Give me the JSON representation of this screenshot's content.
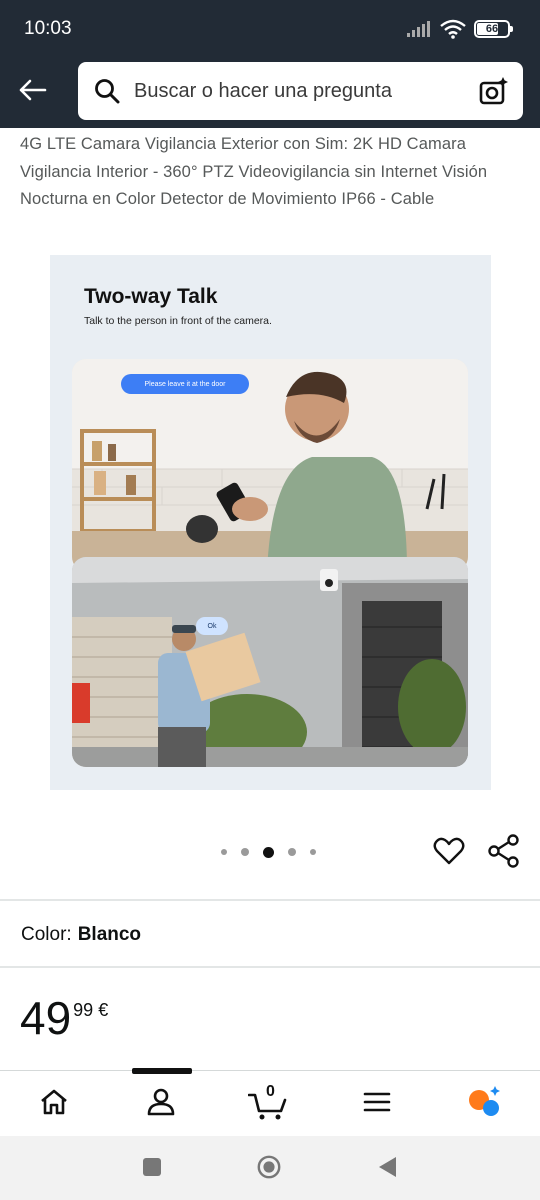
{
  "status_bar": {
    "time": "10:03",
    "battery": "66"
  },
  "search": {
    "placeholder": "Buscar o hacer una pregunta"
  },
  "product": {
    "title": "4G LTE Camara Vigilancia Exterior con Sim: 2K HD Camara Vigilancia Interior - 360° PTZ Videovigilancia sin Internet Visión Nocturna en Color Detector de Movimiento IP66 - Cable",
    "image": {
      "heading": "Two-way Talk",
      "subheading": "Talk to the person in front of the camera.",
      "bubble_top": "Please leave it at the door",
      "bubble_bottom": "Ok"
    },
    "carousel": {
      "total": 5,
      "active_index": 3
    },
    "color_label": "Color:",
    "color_value": "Blanco",
    "price_whole": "49",
    "price_fraction": "99 €"
  },
  "bottom_nav": {
    "cart_count": "0"
  },
  "colors": {
    "header_bg": "#222b36",
    "accent_blue": "#3d7ef5",
    "rufus_orange": "#ff7a1a",
    "rufus_blue": "#1d8bf1"
  }
}
